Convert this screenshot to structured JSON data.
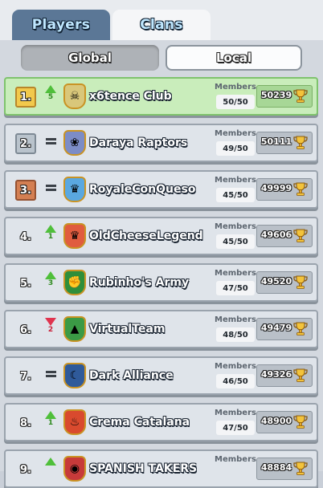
{
  "tabs": {
    "players": "Players",
    "clans": "Clans"
  },
  "scope": {
    "global": "Global",
    "local": "Local"
  },
  "labels": {
    "members": "Members"
  },
  "rows": [
    {
      "rank": "1.",
      "trend": "up",
      "change": "5",
      "name": "x6tence Club",
      "members": "50/50",
      "trophies": "50239",
      "badge_color": "#d9c77a",
      "badge_icon": "skull-icon",
      "highlight": true,
      "rank_style": "r1"
    },
    {
      "rank": "2.",
      "trend": "same",
      "change": "",
      "name": "Daraya Raptors",
      "members": "49/50",
      "trophies": "50111",
      "badge_color": "#7c8cc6",
      "badge_icon": "lotus-icon",
      "highlight": false,
      "rank_style": "r2"
    },
    {
      "rank": "3.",
      "trend": "same",
      "change": "",
      "name": "RoyaleConQueso",
      "members": "45/50",
      "trophies": "49999",
      "badge_color": "#5aa8e0",
      "badge_icon": "crown-icon",
      "highlight": false,
      "rank_style": "r3"
    },
    {
      "rank": "4.",
      "trend": "up",
      "change": "1",
      "name": "OldCheeseLegend",
      "members": "45/50",
      "trophies": "49606",
      "badge_color": "#e05c3f",
      "badge_icon": "crown-icon",
      "highlight": false,
      "rank_style": ""
    },
    {
      "rank": "5.",
      "trend": "up",
      "change": "3",
      "name": "Rubinho's Army",
      "members": "47/50",
      "trophies": "49520",
      "badge_color": "#2f8e3a",
      "badge_icon": "fist-icon",
      "highlight": false,
      "rank_style": ""
    },
    {
      "rank": "6.",
      "trend": "down",
      "change": "2",
      "name": "VirtualTeam",
      "members": "48/50",
      "trophies": "49479",
      "badge_color": "#3b9a45",
      "badge_icon": "triangle-icon",
      "highlight": false,
      "rank_style": ""
    },
    {
      "rank": "7.",
      "trend": "same",
      "change": "",
      "name": "Dark Alliance",
      "members": "46/50",
      "trophies": "49326",
      "badge_color": "#2f5a9a",
      "badge_icon": "moon-icon",
      "highlight": false,
      "rank_style": ""
    },
    {
      "rank": "8.",
      "trend": "up",
      "change": "1",
      "name": "Crema Catalana",
      "members": "47/50",
      "trophies": "48900",
      "badge_color": "#d94a2e",
      "badge_icon": "flame-icon",
      "highlight": false,
      "rank_style": ""
    },
    {
      "rank": "9.",
      "trend": "up",
      "change": "",
      "name": "SPANISH TAKERS",
      "members": "",
      "trophies": "48884",
      "badge_color": "#c73a3a",
      "badge_icon": "eye-icon",
      "highlight": false,
      "rank_style": ""
    }
  ]
}
